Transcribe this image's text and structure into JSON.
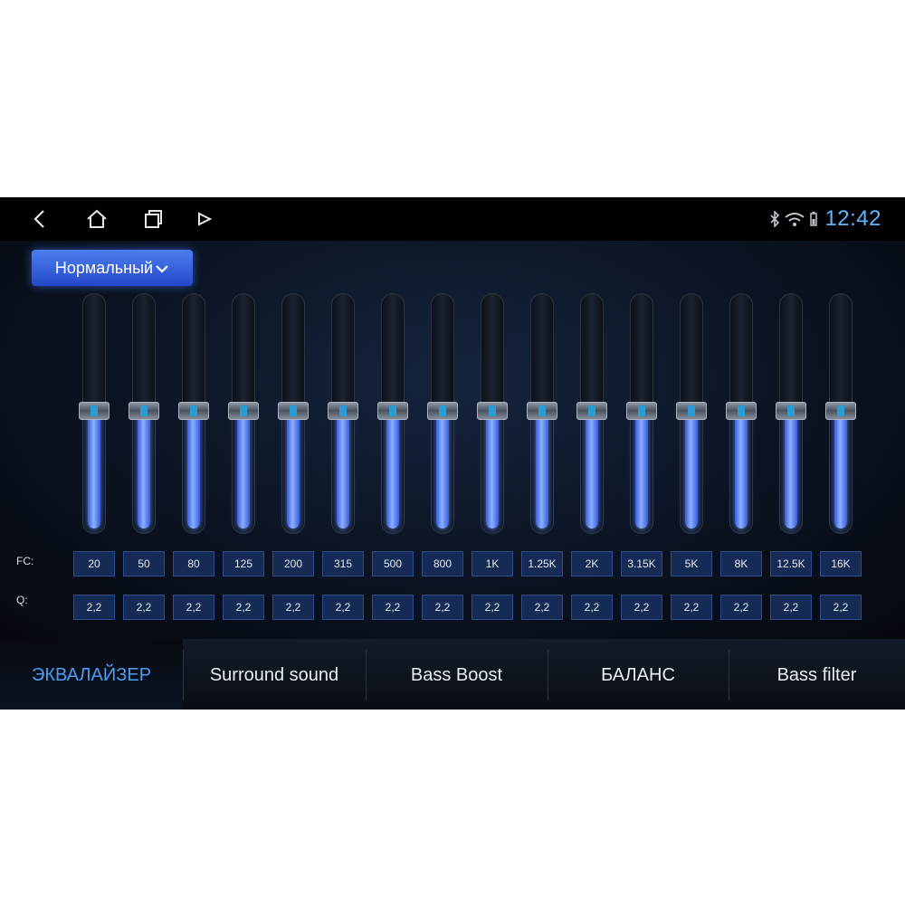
{
  "status_bar": {
    "nav_buttons": [
      "back-icon",
      "home-icon",
      "recents-icon",
      "media-icon"
    ],
    "status_icons": [
      "bluetooth-icon",
      "wifi-icon",
      "battery-icon"
    ],
    "time": "12:42",
    "accent_color": "#5fb8ff"
  },
  "preset": {
    "label": "Нормальный",
    "icon": "chevron-down-icon"
  },
  "equalizer": {
    "fc_label": "FC:",
    "q_label": "Q:",
    "bands": [
      {
        "fc": "20",
        "q": "2,2",
        "level": 0.5
      },
      {
        "fc": "50",
        "q": "2,2",
        "level": 0.5
      },
      {
        "fc": "80",
        "q": "2,2",
        "level": 0.5
      },
      {
        "fc": "125",
        "q": "2,2",
        "level": 0.5
      },
      {
        "fc": "200",
        "q": "2,2",
        "level": 0.5
      },
      {
        "fc": "315",
        "q": "2,2",
        "level": 0.5
      },
      {
        "fc": "500",
        "q": "2,2",
        "level": 0.5
      },
      {
        "fc": "800",
        "q": "2,2",
        "level": 0.5
      },
      {
        "fc": "1K",
        "q": "2,2",
        "level": 0.5
      },
      {
        "fc": "1.25K",
        "q": "2,2",
        "level": 0.5
      },
      {
        "fc": "2K",
        "q": "2,2",
        "level": 0.5
      },
      {
        "fc": "3.15K",
        "q": "2,2",
        "level": 0.5
      },
      {
        "fc": "5K",
        "q": "2,2",
        "level": 0.5
      },
      {
        "fc": "8K",
        "q": "2,2",
        "level": 0.5
      },
      {
        "fc": "12.5K",
        "q": "2,2",
        "level": 0.5
      },
      {
        "fc": "16K",
        "q": "2,2",
        "level": 0.5
      }
    ]
  },
  "tabs": [
    {
      "label": "ЭКВАЛАЙЗЕР",
      "active": true
    },
    {
      "label": "Surround sound",
      "active": false
    },
    {
      "label": "Bass Boost",
      "active": false
    },
    {
      "label": "БАЛАНС",
      "active": false
    },
    {
      "label": "Bass filter",
      "active": false
    }
  ],
  "colors": {
    "active_tab": "#4a9df5",
    "slider_fill": "#6f95ff",
    "preset_button": "#3a63e0"
  }
}
